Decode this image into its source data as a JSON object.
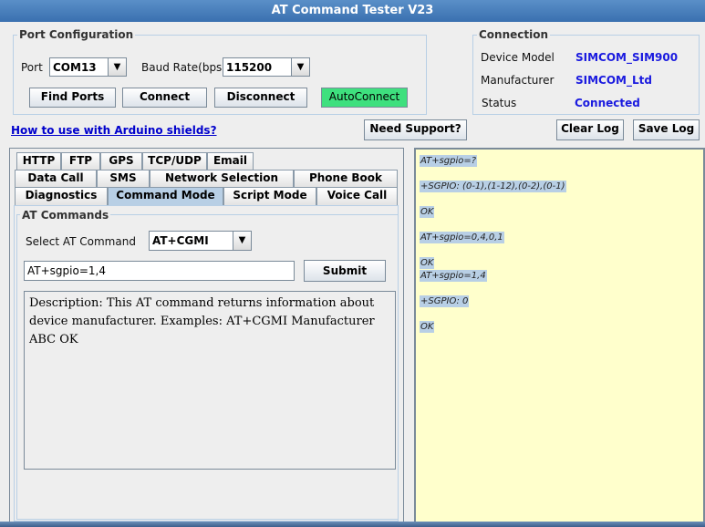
{
  "window": {
    "title": "AT Command Tester V23"
  },
  "port_config": {
    "title": "Port Configuration",
    "port_label": "Port",
    "port_value": "COM13",
    "baud_label": "Baud Rate(bps)",
    "baud_value": "115200",
    "buttons": {
      "find_ports": "Find Ports",
      "connect": "Connect",
      "disconnect": "Disconnect",
      "autoconnect": "AutoConnect"
    }
  },
  "connection": {
    "title": "Connection",
    "device_model_label": "Device Model",
    "device_model_value": "SIMCOM_SIM900",
    "manufacturer_label": "Manufacturer",
    "manufacturer_value": "SIMCOM_Ltd",
    "status_label": "Status",
    "status_value": "Connected"
  },
  "toolbar": {
    "arduino_link": "How to use with Arduino shields?",
    "need_support": "Need Support?",
    "clear_log": "Clear Log",
    "save_log": "Save Log"
  },
  "tabs": {
    "row1": [
      "HTTP",
      "FTP",
      "GPS",
      "TCP/UDP",
      "Email"
    ],
    "row2": [
      "Data Call",
      "SMS",
      "Network Selection",
      "Phone Book"
    ],
    "row3": [
      "Diagnostics",
      "Command Mode",
      "Script Mode",
      "Voice Call"
    ],
    "active": "Command Mode"
  },
  "at_commands": {
    "title": "AT Commands",
    "select_label": "Select AT Command",
    "select_value": "AT+CGMI",
    "input_value": "AT+sgpio=1,4",
    "submit": "Submit",
    "description": "Description: This AT command returns information about device manufacturer. Examples: AT+CGMI Manufacturer ABC OK"
  },
  "log": [
    "AT+sgpio=?",
    "+SGPIO: (0-1),(1-12),(0-2),(0-1)",
    "OK",
    "AT+sgpio=0,4,0,1",
    "OK",
    "AT+sgpio=1,4",
    "+SGPIO: 0",
    "OK"
  ],
  "colors": {
    "title_bar": "#3a70b0",
    "autoconnect": "#3ee07e",
    "log_background": "#ffffcc",
    "log_highlight": "#b8cfe5",
    "connection_value": "#1a1adf"
  }
}
